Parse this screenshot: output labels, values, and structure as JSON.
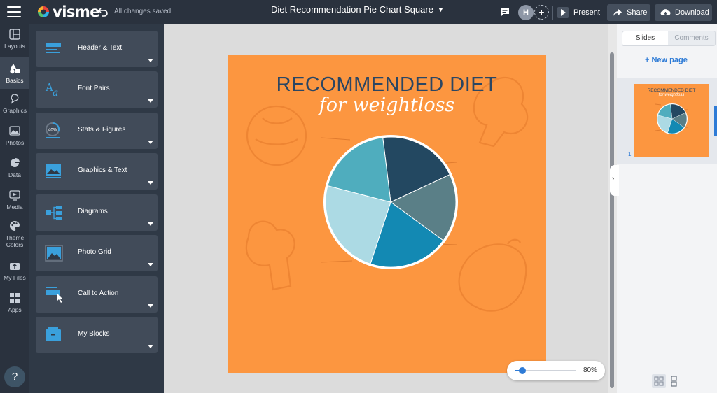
{
  "app": {
    "logo_text": "visme",
    "save_status": "All changes saved",
    "document_title": "Diet Recommendation Pie Chart Square"
  },
  "header": {
    "avatar_initial": "H",
    "present_label": "Present",
    "share_label": "Share",
    "download_label": "Download"
  },
  "rail": {
    "items": [
      {
        "label": "Layouts",
        "icon": "layout-icon"
      },
      {
        "label": "Basics",
        "icon": "shapes-icon"
      },
      {
        "label": "Graphics",
        "icon": "graphics-icon"
      },
      {
        "label": "Photos",
        "icon": "photo-icon"
      },
      {
        "label": "Data",
        "icon": "pie-chart-icon"
      },
      {
        "label": "Media",
        "icon": "media-icon"
      },
      {
        "label": "Theme Colors",
        "icon": "palette-icon"
      },
      {
        "label": "My Files",
        "icon": "upload-icon"
      },
      {
        "label": "Apps",
        "icon": "apps-icon"
      }
    ],
    "help_label": "?"
  },
  "panel": {
    "blocks": [
      {
        "label": "Header & Text",
        "icon": "header-text-icon"
      },
      {
        "label": "Font Pairs",
        "icon": "font-pairs-icon"
      },
      {
        "label": "Stats & Figures",
        "icon": "stats-icon"
      },
      {
        "label": "Graphics & Text",
        "icon": "graphics-text-icon"
      },
      {
        "label": "Diagrams",
        "icon": "diagram-icon"
      },
      {
        "label": "Photo Grid",
        "icon": "photo-grid-icon"
      },
      {
        "label": "Call to Action",
        "icon": "call-to-action-icon"
      },
      {
        "label": "My Blocks",
        "icon": "my-blocks-icon"
      }
    ],
    "stats_icon_text": "40%"
  },
  "slide": {
    "title": "RECOMMENDED DIET",
    "subtitle": "for weightloss"
  },
  "chart_data": {
    "type": "pie",
    "title": "RECOMMENDED DIET",
    "slices": [
      {
        "value": 20,
        "color": "#234861"
      },
      {
        "value": 17,
        "color": "#5a7f87"
      },
      {
        "value": 20,
        "color": "#1389b3"
      },
      {
        "value": 24,
        "color": "#acdae4"
      },
      {
        "value": 19,
        "color": "#4fadbe"
      }
    ]
  },
  "zoom": {
    "value_label": "80%",
    "level": 0.12
  },
  "right_panel": {
    "tab_slides": "Slides",
    "tab_comments": "Comments",
    "new_page_label": "+ New page",
    "slide_number": "1",
    "thumb_title": "RECOMMENDED DIET",
    "thumb_subtitle": "for weightloss"
  },
  "colors": {
    "slide_bg": "#fc9640",
    "title": "#2b4663",
    "accent": "#2e7bd6",
    "topbar": "#2a323e"
  }
}
